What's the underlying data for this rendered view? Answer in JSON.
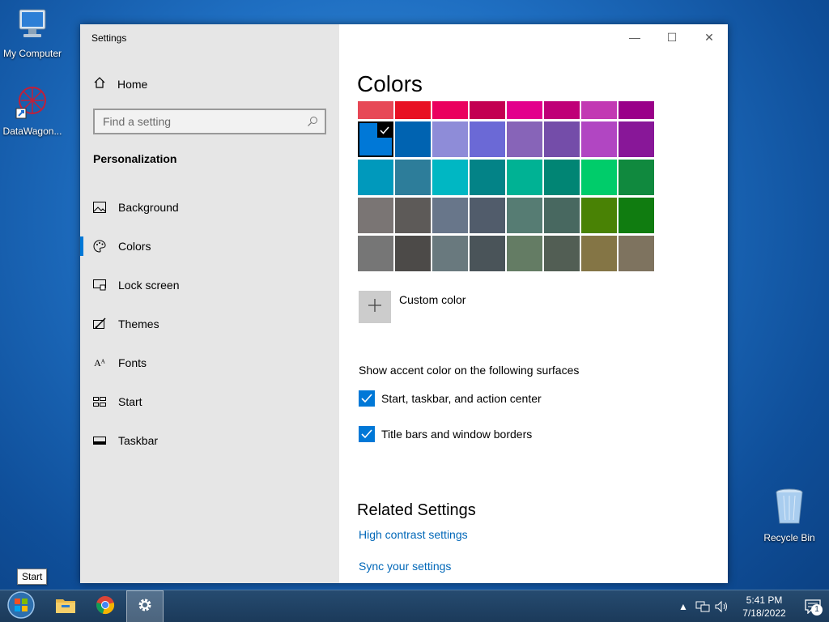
{
  "desktop": {
    "icons": [
      {
        "label": "My Computer",
        "icon": "computer-icon"
      },
      {
        "label": "DataWagon...",
        "icon": "datawagon-shortcut-icon"
      },
      {
        "label": "Recycle Bin",
        "icon": "recycle-bin-icon"
      }
    ]
  },
  "window": {
    "app_title": "Settings",
    "controls": {
      "minimize": "—",
      "maximize": "☐",
      "close": "✕"
    }
  },
  "sidebar": {
    "home_label": "Home",
    "search_placeholder": "Find a setting",
    "section_label": "Personalization",
    "items": [
      {
        "label": "Background",
        "icon": "picture-icon"
      },
      {
        "label": "Colors",
        "icon": "palette-icon",
        "active": true
      },
      {
        "label": "Lock screen",
        "icon": "lock-screen-icon"
      },
      {
        "label": "Themes",
        "icon": "themes-icon"
      },
      {
        "label": "Fonts",
        "icon": "fonts-icon"
      },
      {
        "label": "Start",
        "icon": "start-icon"
      },
      {
        "label": "Taskbar",
        "icon": "taskbar-icon"
      }
    ]
  },
  "main": {
    "title": "Colors",
    "palette": {
      "selected": "#0078d7",
      "rows": [
        [
          "#e74856",
          "#e81123",
          "#ea005e",
          "#c30052",
          "#e3008c",
          "#bf0077",
          "#c239b3",
          "#9a0089"
        ],
        [
          "#0078d7",
          "#0063b1",
          "#8e8cd8",
          "#6b69d6",
          "#8764b8",
          "#744da9",
          "#b146c2",
          "#881798"
        ],
        [
          "#0099bc",
          "#2d7d9a",
          "#00b7c3",
          "#038387",
          "#00b294",
          "#018574",
          "#00cc6a",
          "#10893e"
        ],
        [
          "#7a7574",
          "#5d5a58",
          "#68768a",
          "#515c6b",
          "#567c73",
          "#486860",
          "#498205",
          "#107c10"
        ],
        [
          "#767676",
          "#4c4a48",
          "#69797e",
          "#4a5459",
          "#647c64",
          "#525e54",
          "#847545",
          "#7e735f"
        ]
      ]
    },
    "custom_color_label": "Custom color",
    "surfaces_title": "Show accent color on the following surfaces",
    "checkboxes": [
      {
        "label": "Start, taskbar, and action center",
        "checked": true
      },
      {
        "label": "Title bars and window borders",
        "checked": true
      }
    ],
    "related_title": "Related Settings",
    "links": [
      "High contrast settings",
      "Sync your settings"
    ]
  },
  "taskbar": {
    "tooltip": "Start",
    "clock_time": "5:41 PM",
    "clock_date": "7/18/2022",
    "notification_count": "1"
  },
  "colors": {
    "accent": "#0078d7",
    "link": "#0067b8"
  }
}
